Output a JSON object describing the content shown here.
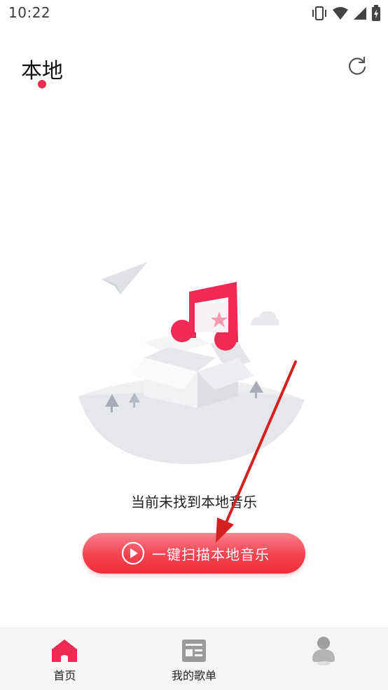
{
  "status_bar": {
    "time": "10:22",
    "icons": [
      "vibrate-icon",
      "wifi-icon",
      "signal-icon",
      "battery-icon"
    ]
  },
  "header": {
    "title": "本地",
    "refresh_icon": "refresh-icon"
  },
  "empty_state": {
    "message": "当前未找到本地音乐",
    "illustration": "music-box-illustration"
  },
  "scan_button": {
    "label": "一键扫描本地音乐",
    "icon": "play-circle-icon"
  },
  "bottom_nav": {
    "items": [
      {
        "label": "首页",
        "icon": "home-icon",
        "active": true
      },
      {
        "label": "我的歌单",
        "icon": "playlist-icon",
        "active": false
      },
      {
        "label": "",
        "icon": "profile-icon",
        "active": false
      }
    ]
  },
  "colors": {
    "accent": "#ee2a55",
    "button_gradient_top": "#f7808c",
    "button_gradient_bottom": "#ee2d3a",
    "nav_background": "#f5f5f5",
    "annotation": "#d42020"
  }
}
